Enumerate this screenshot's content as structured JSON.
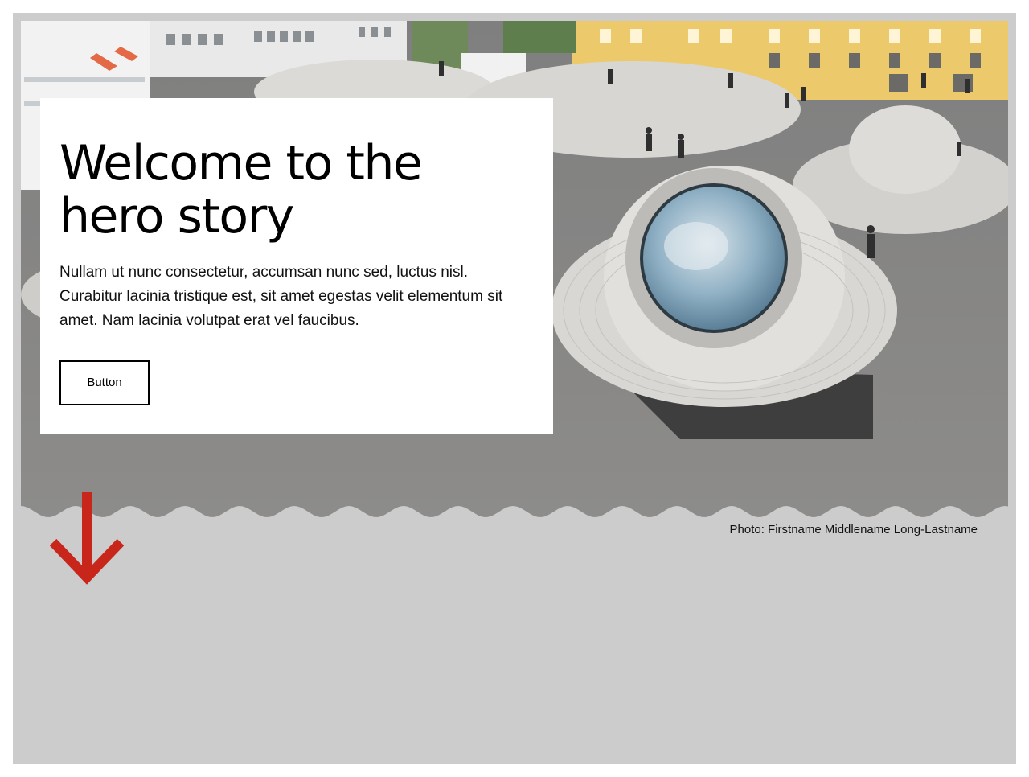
{
  "hero": {
    "title": "Welcome to the hero story",
    "body": "Nullam ut nunc consectetur, accumsan nunc sed, luctus nisl. Curabitur lacinia tristique est, sit amet egestas velit elementum sit amet. Nam lacinia volutpat erat vel faucibus.",
    "button_label": "Button",
    "photo_credit": "Photo: Firstname Middlename Long-Lastname",
    "scroll_icon": "arrow-down-icon"
  },
  "colors": {
    "background": "#cccccc",
    "card": "#ffffff",
    "text": "#000000",
    "arrow": "#c8261b"
  }
}
